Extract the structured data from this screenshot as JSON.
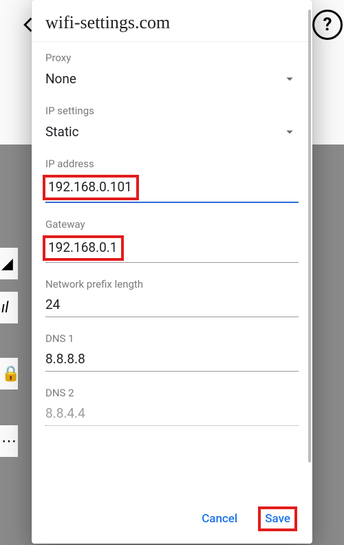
{
  "dialog": {
    "title": "wifi-settings.com",
    "proxy": {
      "label": "Proxy",
      "value": "None"
    },
    "ip_settings": {
      "label": "IP settings",
      "value": "Static"
    },
    "ip_address": {
      "label": "IP address",
      "value": "192.168.0.101"
    },
    "gateway": {
      "label": "Gateway",
      "value": "192.168.0.1"
    },
    "prefix": {
      "label": "Network prefix length",
      "value": "24"
    },
    "dns1": {
      "label": "DNS 1",
      "value": "8.8.8.8"
    },
    "dns2": {
      "label": "DNS 2",
      "placeholder": "8.8.4.4"
    },
    "actions": {
      "cancel": "Cancel",
      "save": "Save"
    }
  }
}
